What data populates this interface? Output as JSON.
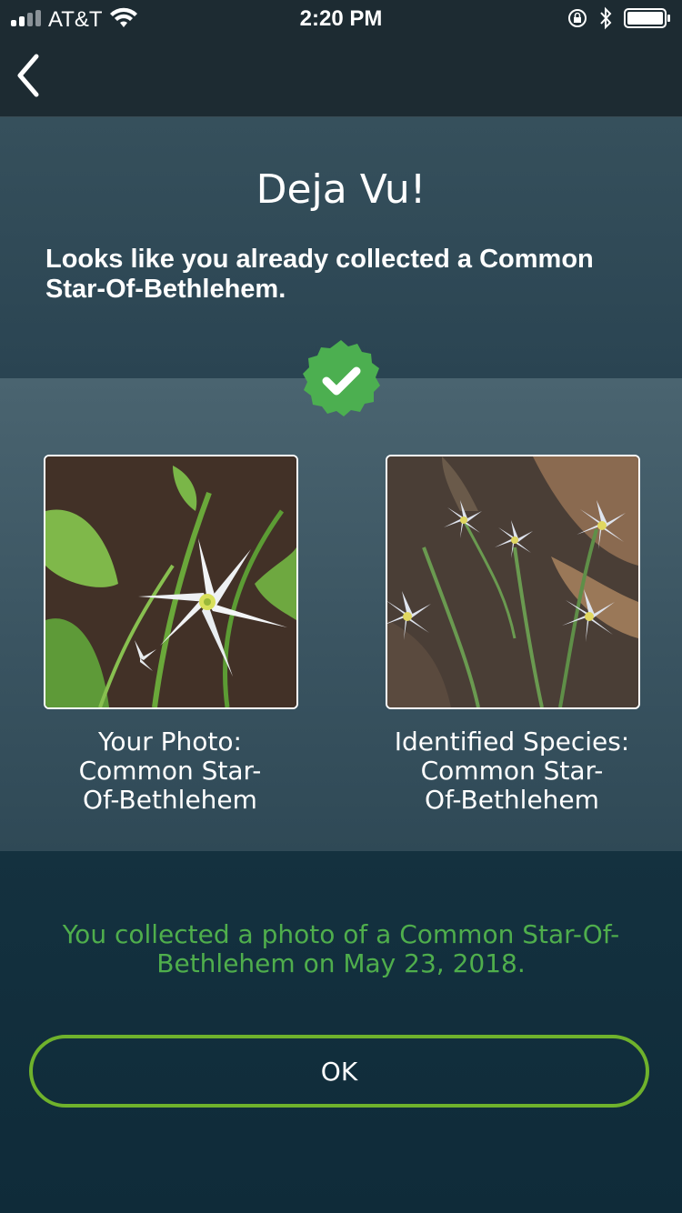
{
  "status_bar": {
    "carrier": "AT&T",
    "time": "2:20 PM"
  },
  "nav": {
    "back_icon": "chevron-left-icon"
  },
  "header": {
    "title": "Deja Vu!",
    "subtitle": "Looks like you already collected a Common Star-Of-Bethlehem."
  },
  "badge": {
    "icon": "checkmark-badge-icon",
    "color": "#4caf50"
  },
  "photos": {
    "left": {
      "caption_line1": "Your Photo:",
      "caption_line2": "Common Star-",
      "caption_line3": "Of-Bethlehem"
    },
    "right": {
      "caption_line1": "Identified Species:",
      "caption_line2": "Common Star-",
      "caption_line3": "Of-Bethlehem"
    }
  },
  "message": "You collected a photo of a Common Star-Of-Bethlehem on May 23, 2018.",
  "ok_button": {
    "label": "OK",
    "border_color": "#6fb22c"
  },
  "colors": {
    "accent_green": "#4fae4c",
    "nav_background": "#1d2b32",
    "page_background": "#0f2b39"
  }
}
